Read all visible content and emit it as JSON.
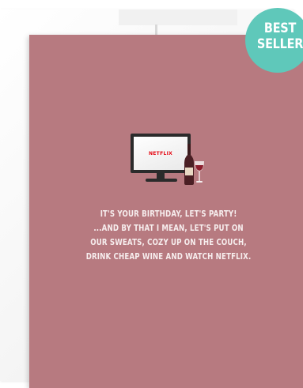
{
  "product": {
    "badge": {
      "line1": "BEST",
      "line2": "SELLER"
    },
    "tv_logo": "NETFLIX",
    "message_lines": [
      "IT'S YOUR BIRTHDAY, LET'S PARTY!",
      "...AND BY THAT I MEAN, LET'S PUT ON",
      "OUR SWEATS, COZY UP ON THE COUCH,",
      "DRINK CHEAP WINE AND WATCH NETFLIX."
    ]
  },
  "colors": {
    "card": "#b77a80",
    "badge": "#5fc8ba",
    "text": "#f7eeee",
    "logo": "#e50914"
  }
}
